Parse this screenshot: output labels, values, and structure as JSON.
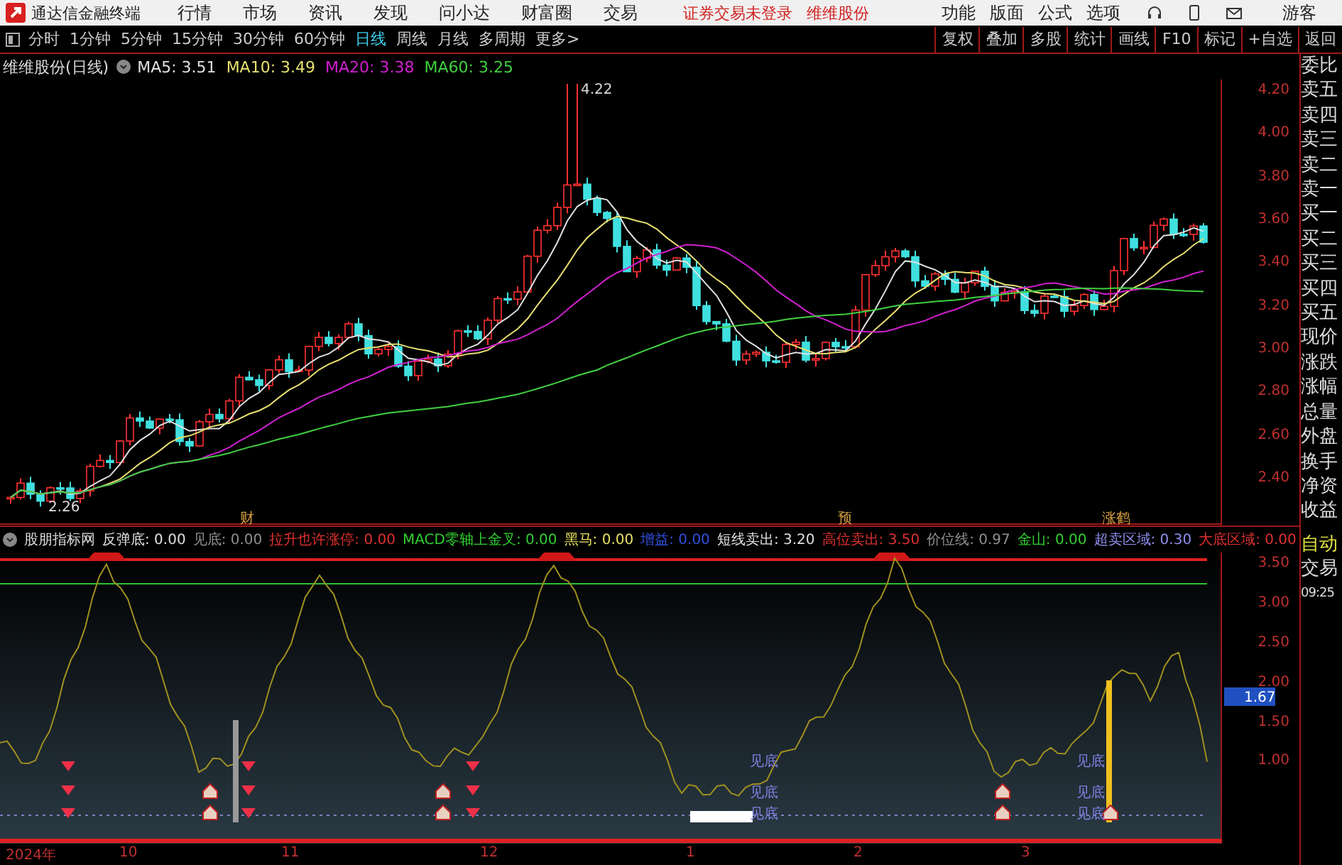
{
  "app": {
    "title": "通达信金融终端"
  },
  "menu": [
    "行情",
    "市场",
    "资讯",
    "发现",
    "问小达",
    "财富圈",
    "交易"
  ],
  "notice": {
    "login": "证券交易未登录",
    "stock": "维维股份"
  },
  "right_menu": [
    "功能",
    "版面",
    "公式",
    "选项"
  ],
  "user": "游客",
  "periods": [
    {
      "label": "分时",
      "selected": false
    },
    {
      "label": "1分钟",
      "selected": false
    },
    {
      "label": "5分钟",
      "selected": false
    },
    {
      "label": "15分钟",
      "selected": false
    },
    {
      "label": "30分钟",
      "selected": false
    },
    {
      "label": "60分钟",
      "selected": false
    },
    {
      "label": "日线",
      "selected": true
    },
    {
      "label": "周线",
      "selected": false
    },
    {
      "label": "月线",
      "selected": false
    },
    {
      "label": "多周期",
      "selected": false
    },
    {
      "label": "更多>",
      "selected": false
    }
  ],
  "tools": [
    "复权",
    "叠加",
    "多股",
    "统计",
    "画线",
    "F10",
    "标记",
    "+自选",
    "返回"
  ],
  "chart": {
    "title": "维维股份(日线)",
    "ma": [
      {
        "label": "MA5: 3.51",
        "color": "#e0e0e0"
      },
      {
        "label": "MA10: 3.49",
        "color": "#e8e070"
      },
      {
        "label": "MA20: 3.38",
        "color": "#d020d0"
      },
      {
        "label": "MA60: 3.25",
        "color": "#40d040"
      }
    ],
    "high_label": "4.22",
    "low_label": "2.26",
    "event_labels": [
      "财",
      "预",
      "涨鹤"
    ],
    "y_ticks": [
      "4.20",
      "4.00",
      "3.80",
      "3.60",
      "3.40",
      "3.20",
      "3.00",
      "2.80",
      "2.60",
      "2.40"
    ]
  },
  "indicator": {
    "name": "股朋指标网",
    "items": [
      {
        "label": "反弹底: 0.00",
        "color": "#e0e0e0"
      },
      {
        "label": "见底: 0.00",
        "color": "#909090"
      },
      {
        "label": "拉升也许涨停: 0.00",
        "color": "#e03030"
      },
      {
        "label": "MACD零轴上金叉: 0.00",
        "color": "#30d030"
      },
      {
        "label": "黑马: 0.00",
        "color": "#e8e060"
      },
      {
        "label": "增益: 0.00",
        "color": "#3050e0"
      },
      {
        "label": "短线卖出: 3.20",
        "color": "#e0e0e0"
      },
      {
        "label": "高位卖出: 3.50",
        "color": "#e03030"
      },
      {
        "label": "价位线: 0.97",
        "color": "#909090"
      },
      {
        "label": "金山: 0.00",
        "color": "#30d030"
      },
      {
        "label": "超卖区域: 0.30",
        "color": "#9090f0"
      },
      {
        "label": "大底区域: 0.00",
        "color": "#e03030"
      }
    ],
    "signals": [
      "见底",
      "见底",
      "见底",
      "见底",
      "见底",
      "见底"
    ],
    "y_ticks": [
      "3.50",
      "3.00",
      "2.50",
      "2.00",
      "1.50",
      "1.00"
    ],
    "current_value": "1.67"
  },
  "dates": [
    "2024年",
    "10",
    "11",
    "12",
    "1",
    "2",
    "3"
  ],
  "quote_labels": [
    "委比",
    "卖五",
    "卖四",
    "卖三",
    "卖二",
    "卖一",
    "买一",
    "买二",
    "买三",
    "买四",
    "买五",
    "现价",
    "涨跌",
    "涨幅",
    "总量",
    "外盘",
    "换手",
    "净资",
    "收益"
  ],
  "auto_label": "自动",
  "trade_label": "交易",
  "time": "09:25"
}
